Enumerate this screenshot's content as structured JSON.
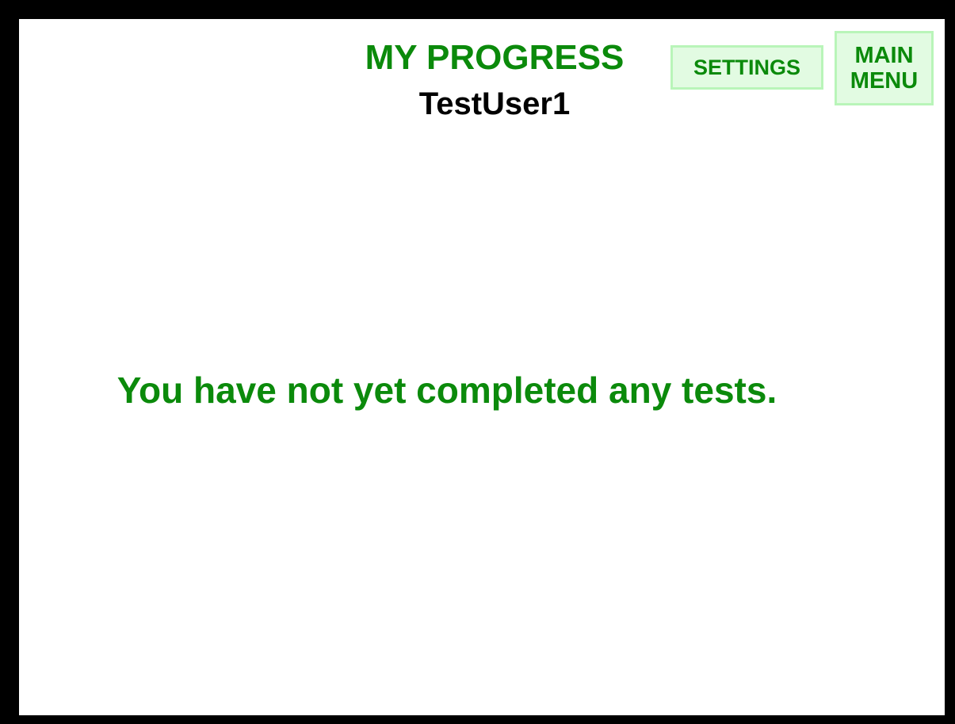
{
  "header": {
    "title": "MY PROGRESS",
    "username": "TestUser1"
  },
  "buttons": {
    "settings_label": "SETTINGS",
    "main_menu_line1": "MAIN",
    "main_menu_line2": "MENU"
  },
  "main": {
    "empty_message": "You have not yet completed any tests."
  },
  "colors": {
    "frame": "#000000",
    "background": "#ffffff",
    "accent_text": "#0b8a0b",
    "button_fill": "#e2fbe2",
    "button_border": "#b9f5b9"
  }
}
